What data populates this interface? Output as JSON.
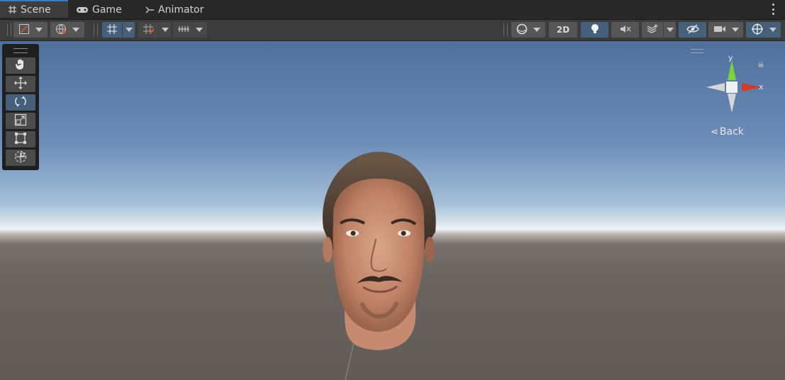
{
  "tabs": [
    {
      "label": "Scene",
      "icon": "grid-icon",
      "active": true
    },
    {
      "label": "Game",
      "icon": "gamepad-icon",
      "active": false
    },
    {
      "label": "Animator",
      "icon": "animator-icon",
      "active": false
    }
  ],
  "toolbar": {
    "mode_2d_label": "2D"
  },
  "tools": [
    {
      "name": "hand-tool",
      "icon": "hand-icon",
      "active": false
    },
    {
      "name": "move-tool",
      "icon": "move-arrows-icon",
      "active": false
    },
    {
      "name": "rotate-tool",
      "icon": "rotate-icon",
      "active": true
    },
    {
      "name": "scale-tool",
      "icon": "scale-icon",
      "active": false
    },
    {
      "name": "rect-tool",
      "icon": "rect-icon",
      "active": false
    },
    {
      "name": "transform-tool",
      "icon": "transform-icon",
      "active": false
    }
  ],
  "gizmo": {
    "y_label": "y",
    "x_label": "x",
    "view_label": "Back"
  },
  "colors": {
    "accent": "#46607c",
    "active_tab_border": "#3a79bb",
    "axis_x": "#d23c2a",
    "axis_y": "#7bd33c"
  }
}
